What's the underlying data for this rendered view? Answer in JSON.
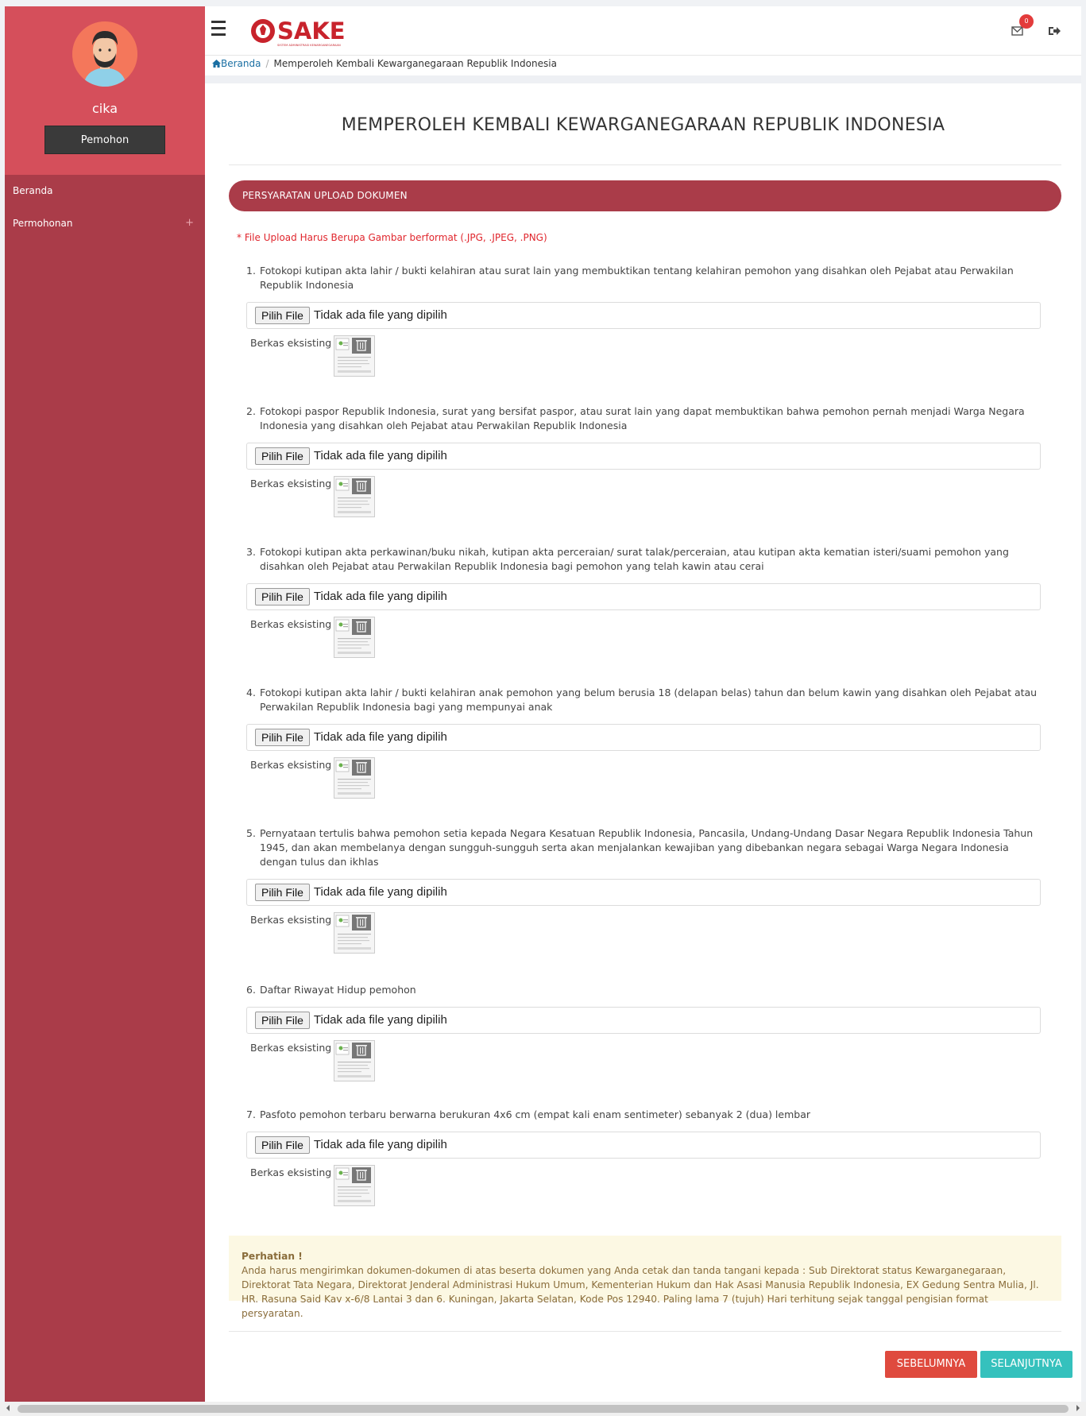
{
  "profile": {
    "name": "cika",
    "role": "Pemohon"
  },
  "nav": {
    "beranda": "Beranda",
    "permohonan": "Permohonan",
    "permohonan_plus": "+"
  },
  "header": {
    "logo_text": "SAKE",
    "logo_subtitle": "SISTEM ADMINISTRASI KEWARGANEGARAAN",
    "notification_count": "0"
  },
  "breadcrumb": {
    "home": "Beranda",
    "separator": "/",
    "current": "Memperoleh Kembali Kewarganegaraan Republik Indonesia"
  },
  "page": {
    "title": "MEMPEROLEH KEMBALI KEWARGANEGARAAN REPUBLIK INDONESIA",
    "section_title": "PERSYARATAN UPLOAD DOKUMEN",
    "note": "* File Upload Harus Berupa Gambar berformat (.JPG, .JPEG, .PNG)"
  },
  "file_input": {
    "button_label": "Pilih File",
    "no_file_text": "Tidak ada file yang dipilih",
    "existing_label": "Berkas eksisting"
  },
  "requirements": [
    {
      "num": "1.",
      "text": "Fotokopi kutipan akta lahir / bukti kelahiran atau surat lain yang membuktikan tentang kelahiran pemohon yang disahkan oleh Pejabat atau Perwakilan Republik Indonesia"
    },
    {
      "num": "2.",
      "text": "Fotokopi paspor Republik Indonesia, surat yang bersifat paspor, atau surat lain yang dapat membuktikan bahwa pemohon pernah menjadi Warga Negara Indonesia yang disahkan oleh Pejabat atau Perwakilan Republik Indonesia"
    },
    {
      "num": "3.",
      "text": "Fotokopi kutipan akta perkawinan/buku nikah, kutipan akta perceraian/ surat talak/perceraian, atau kutipan akta kematian isteri/suami pemohon yang disahkan oleh Pejabat atau Perwakilan Republik Indonesia bagi pemohon yang telah kawin atau cerai"
    },
    {
      "num": "4.",
      "text": "Fotokopi kutipan akta lahir / bukti kelahiran anak pemohon yang belum berusia 18 (delapan belas) tahun dan belum kawin yang disahkan oleh Pejabat atau Perwakilan Republik Indonesia bagi yang mempunyai anak"
    },
    {
      "num": "5.",
      "text": "Pernyataan tertulis bahwa pemohon setia kepada Negara Kesatuan Republik Indonesia, Pancasila, Undang-Undang Dasar Negara Republik Indonesia Tahun 1945, dan akan membelanya dengan sungguh-sungguh serta akan menjalankan kewajiban yang dibebankan negara sebagai Warga Negara Indonesia dengan tulus dan ikhlas"
    },
    {
      "num": "6.",
      "text": "Daftar Riwayat Hidup pemohon"
    },
    {
      "num": "7.",
      "text": "Pasfoto pemohon terbaru berwarna berukuran 4x6 cm (empat kali enam sentimeter) sebanyak 2 (dua) lembar"
    }
  ],
  "warning": {
    "title": "Perhatian !",
    "body": "Anda harus mengirimkan dokumen-dokumen di atas beserta dokumen yang Anda cetak dan tanda tangani kepada : Sub Direktorat status Kewarganegaraan, Direktorat Tata Negara, Direktorat Jenderal Administrasi Hukum Umum, Kementerian Hukum dan Hak Asasi Manusia Republik Indonesia, EX Gedung Sentra Mulia, Jl. HR. Rasuna Said Kav x-6/8 Lantai 3 dan 6. Kuningan, Jakarta Selatan, Kode Pos 12940. Paling lama 7 (tujuh) Hari terhitung sejak tanggal pengisian format persyaratan."
  },
  "buttons": {
    "prev": "SEBELUMNYA",
    "next": "SELANJUTNYA"
  },
  "colors": {
    "sidebar": "#aa3c49",
    "profile": "#d54f5b",
    "prev_button": "#df4a3e",
    "next_button": "#35c1bd",
    "note": "#e0262d"
  }
}
